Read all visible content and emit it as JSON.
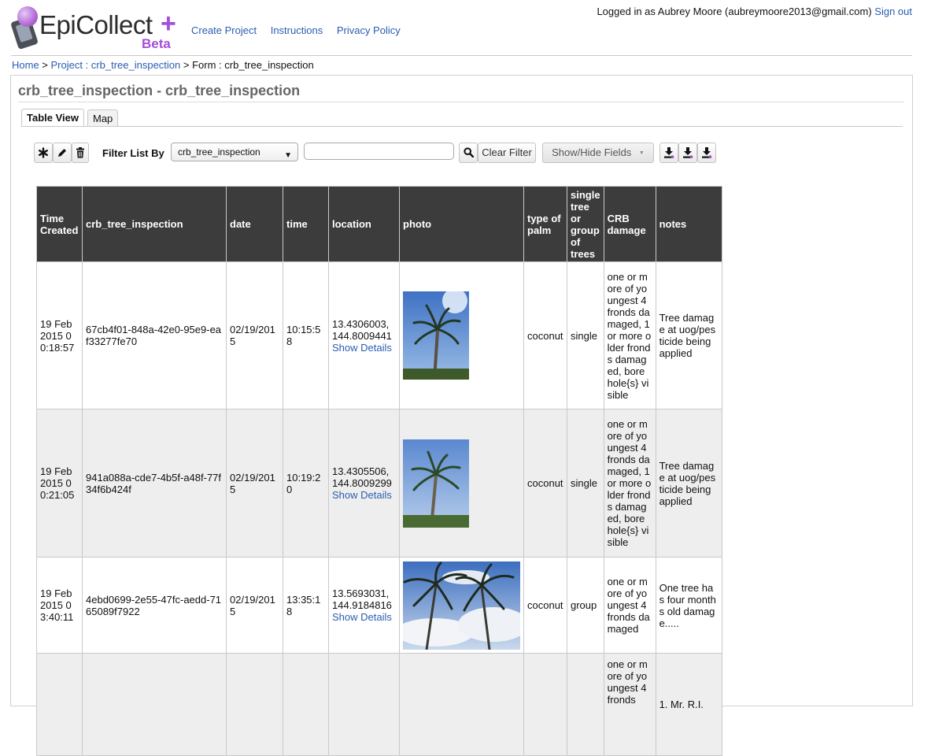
{
  "header": {
    "logo_text": "EpiCollect",
    "logo_plus": "+",
    "logo_beta": "Beta",
    "nav": [
      "Create Project",
      "Instructions",
      "Privacy Policy"
    ],
    "login_prefix": "Logged in as Aubrey Moore (aubreymoore2013@gmail.com)",
    "signout": "Sign out"
  },
  "breadcrumb": {
    "home": "Home",
    "sep1": " > ",
    "project_link": "Project : crb_tree_inspection",
    "sep2": " > ",
    "form": "Form : crb_tree_inspection"
  },
  "form_title": "crb_tree_inspection - crb_tree_inspection",
  "tabs": [
    {
      "label": "Table View",
      "active": true
    },
    {
      "label": "Map",
      "active": false
    }
  ],
  "toolbar": {
    "filter_label": "Filter List By",
    "filter_selected": "crb_tree_inspection",
    "filter_value": "",
    "clear_filter": "Clear Filter",
    "show_hide": "Show/Hide Fields",
    "icons": [
      "asterisk-icon",
      "pencil-icon",
      "trash-icon",
      "search-icon",
      "download-icon",
      "download-icon",
      "download-icon"
    ]
  },
  "table": {
    "columns": [
      "Time Created",
      "crb_tree_inspection",
      "date",
      "time",
      "location",
      "photo",
      "type of palm",
      "single tree or group of trees",
      "CRB damage",
      "notes"
    ],
    "rows": [
      {
        "time_created": "19 Feb 2015 00:18:57",
        "id": "67cb4f01-848a-42e0-95e9-eaf33277fe70",
        "date": "02/19/2015",
        "time": "10:15:58",
        "location": "13.4306003, 144.8009441",
        "details": "Show Details",
        "photo": "palm-photo-tall",
        "palm": "coconut",
        "group": "single",
        "damage": "one or more of youngest 4 fronds damaged, 1 or more older fronds damaged, bore hole{s} visible",
        "notes": "Tree damage at uog/pesticide being applied"
      },
      {
        "time_created": "19 Feb 2015 00:21:05",
        "id": "941a088a-cde7-4b5f-a48f-77f34f6b424f",
        "date": "02/19/2015",
        "time": "10:19:20",
        "location": "13.4305506, 144.8009299",
        "details": "Show Details",
        "photo": "palm-photo-tall",
        "palm": "coconut",
        "group": "single",
        "damage": "one or more of youngest 4 fronds damaged, 1 or more older fronds damaged, bore hole{s} visible",
        "notes": "Tree damage at uog/pesticide being applied"
      },
      {
        "time_created": "19 Feb 2015 03:40:11",
        "id": "4ebd0699-2e55-47fc-aedd-7165089f7922",
        "date": "02/19/2015",
        "time": "13:35:18",
        "location": "13.5693031, 144.9184816",
        "details": "Show Details",
        "photo": "palm-photo-wide",
        "palm": "coconut",
        "group": "group",
        "damage": "one or more of youngest 4 fronds damaged",
        "notes": "One tree has four months old damage....."
      },
      {
        "time_created": "",
        "id": "",
        "date": "",
        "time": "",
        "location": "",
        "details": "",
        "photo": "",
        "palm": "",
        "group": "",
        "damage": "one or more of youngest 4 fronds",
        "notes": "1. Mr. R.I."
      }
    ]
  },
  "colors": {
    "link": "#2a5db0",
    "header_bg": "#3c3c3c",
    "alt_row": "#eeeeee",
    "brand_purple": "#a34fd6"
  }
}
